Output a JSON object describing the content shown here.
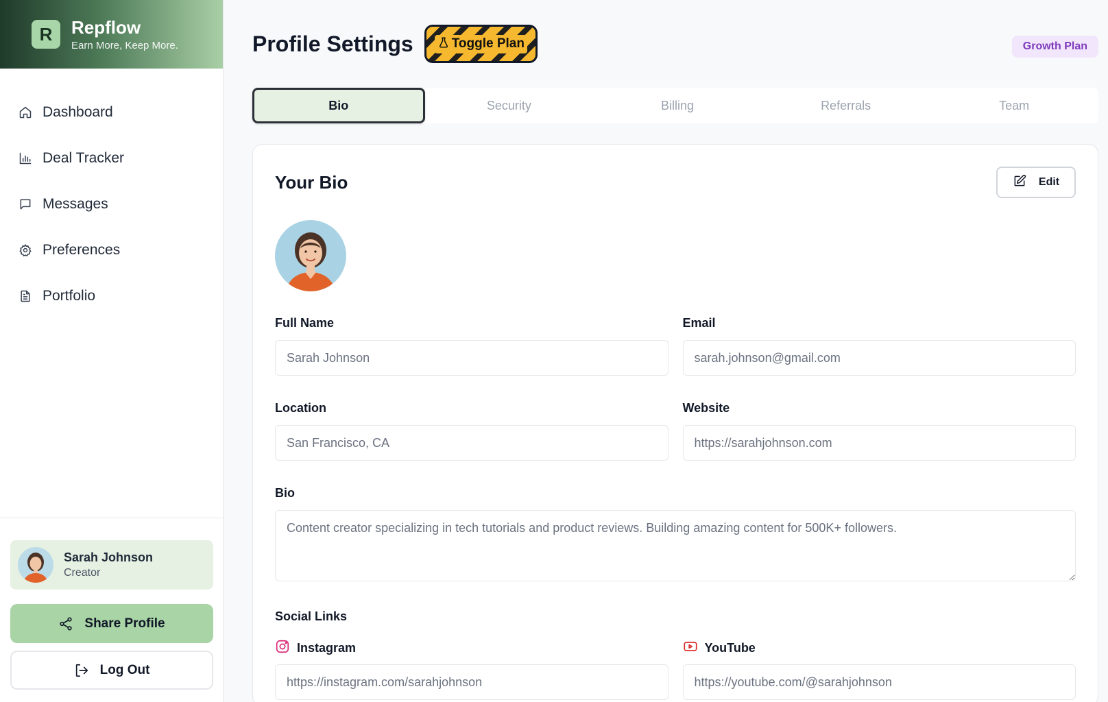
{
  "brand": {
    "logo_letter": "R",
    "name": "Repflow",
    "tagline": "Earn More, Keep More."
  },
  "sidebar": {
    "items": [
      {
        "label": "Dashboard",
        "icon": "home-icon"
      },
      {
        "label": "Deal Tracker",
        "icon": "bar-chart-icon"
      },
      {
        "label": "Messages",
        "icon": "message-icon"
      },
      {
        "label": "Preferences",
        "icon": "gear-icon"
      },
      {
        "label": "Portfolio",
        "icon": "document-icon"
      }
    ],
    "user": {
      "name": "Sarah Johnson",
      "role": "Creator"
    },
    "share_label": "Share Profile",
    "logout_label": "Log Out"
  },
  "header": {
    "title": "Profile Settings",
    "toggle_label": "Toggle Plan",
    "plan_badge": "Growth Plan"
  },
  "tabs": [
    {
      "label": "Bio",
      "active": true
    },
    {
      "label": "Security",
      "active": false
    },
    {
      "label": "Billing",
      "active": false
    },
    {
      "label": "Referrals",
      "active": false
    },
    {
      "label": "Team",
      "active": false
    }
  ],
  "bio_card": {
    "title": "Your Bio",
    "edit_label": "Edit",
    "fields": {
      "full_name": {
        "label": "Full Name",
        "value": "Sarah Johnson"
      },
      "email": {
        "label": "Email",
        "value": "sarah.johnson@gmail.com"
      },
      "location": {
        "label": "Location",
        "value": "San Francisco, CA"
      },
      "website": {
        "label": "Website",
        "value": "https://sarahjohnson.com"
      },
      "bio": {
        "label": "Bio",
        "value": "Content creator specializing in tech tutorials and product reviews. Building amazing content for 500K+ followers."
      }
    },
    "social": {
      "title": "Social Links",
      "instagram": {
        "label": "Instagram",
        "value": "https://instagram.com/sarahjohnson",
        "color": "#db2777"
      },
      "youtube": {
        "label": "YouTube",
        "value": "https://youtube.com/@sarahjohnson",
        "color": "#dc2626"
      }
    }
  },
  "colors": {
    "accent_green": "#a9d4a6",
    "active_tab_bg": "#e6f1e4",
    "plan_badge_text": "#7e3bbd",
    "plan_badge_bg": "#f1e6fb",
    "toggle_yellow": "#f5b82e"
  }
}
